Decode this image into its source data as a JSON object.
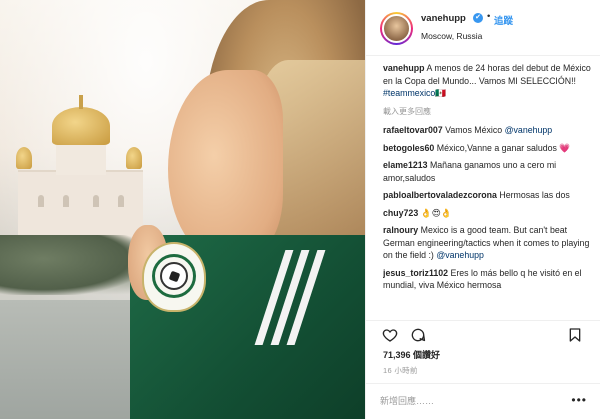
{
  "post": {
    "username": "vanehupp",
    "follow_label": "追蹤",
    "dot": "•",
    "location": "Moscow, Russia",
    "caption_user": "vanehupp",
    "caption_text": " A menos de 24 horas del debut de México en la Copa del Mundo... Vamos MI SELECCIÓN!! ",
    "caption_hashtag": "#teammexico",
    "caption_flag": "🇲🇽",
    "load_more": "載入更多回應"
  },
  "comments": [
    {
      "user": "rafaeltovar007",
      "text": " Vamos México ",
      "mention": "@vanehupp"
    },
    {
      "user": "betogoles60",
      "text": " México,Vanne a ganar saludos 💗",
      "mention": ""
    },
    {
      "user": "elame1213",
      "text": " Mañana ganamos uno a cero mi amor,saludos",
      "mention": ""
    },
    {
      "user": "pabloalbertovaladezcorona",
      "text": " Hermosas las dos",
      "mention": ""
    },
    {
      "user": "chuy723",
      "text": " 👌😍👌",
      "mention": ""
    },
    {
      "user": "ralnoury",
      "text": " Mexico is a good team. But can't beat German engineering/tactics when it comes to playing on the field :) ",
      "mention": "@vanehupp"
    },
    {
      "user": "jesus_toriz1102",
      "text": " Eres lo más bello q he visitó en el mundial, viva México hermosa",
      "mention": ""
    }
  ],
  "footer": {
    "likes": "71,396 個讚好",
    "time": "16 小時前",
    "add_comment_placeholder": "新增回應……",
    "more_options": "•••"
  },
  "icons": {
    "like": "heart-icon",
    "comment": "comment-bubble-icon",
    "save": "bookmark-icon",
    "verified": "verified-badge-icon"
  },
  "colors": {
    "link": "#3897f0",
    "mention": "#003569",
    "muted": "#999999",
    "text": "#262626"
  }
}
